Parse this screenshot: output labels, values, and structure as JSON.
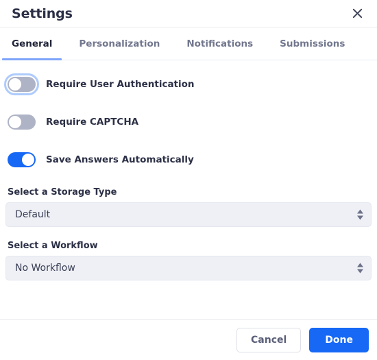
{
  "header": {
    "title": "Settings",
    "close_icon": "close-icon"
  },
  "tabs": [
    {
      "label": "General",
      "active": true
    },
    {
      "label": "Personalization",
      "active": false
    },
    {
      "label": "Notifications",
      "active": false
    },
    {
      "label": "Submissions",
      "active": false
    }
  ],
  "toggles": [
    {
      "label": "Require User Authentication",
      "on": false,
      "focused": true
    },
    {
      "label": "Require CAPTCHA",
      "on": false,
      "focused": false
    },
    {
      "label": "Save Answers Automatically",
      "on": true,
      "focused": false
    }
  ],
  "fields": [
    {
      "label": "Select a Storage Type",
      "value": "Default",
      "icon": "stepper-updown-icon"
    },
    {
      "label": "Select a Workflow",
      "value": "No Workflow",
      "icon": "stepper-updown-icon"
    }
  ],
  "footer": {
    "cancel_label": "Cancel",
    "done_label": "Done"
  },
  "colors": {
    "accent": "#1668f5",
    "tab_underline": "#7da4fb",
    "toggle_off": "#aeb3c6",
    "focus_ring": "#aecbfd",
    "select_bg": "#eef0f5",
    "text_primary": "#2c3046",
    "text_muted": "#72778e",
    "divider": "#e9eaee"
  }
}
